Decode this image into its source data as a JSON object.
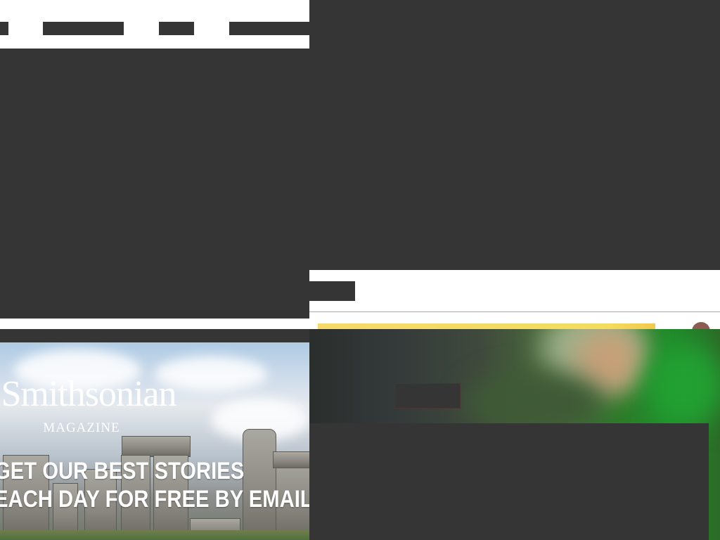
{
  "nav": {
    "items": [
      {
        "label": ""
      },
      {
        "label": ""
      },
      {
        "label": ""
      },
      {
        "label": ""
      }
    ]
  },
  "promo": {
    "logo_title": "Smithsonian",
    "logo_subtitle": "MAGAZINE",
    "headline_line_1": "GET OUR BEST STORIES",
    "headline_line_2": "EACH DAY FOR FREE BY EMAIL"
  },
  "colors": {
    "page_background": "#353535",
    "strip_background": "#ffffff",
    "accent_yellow": "#f4dc5f",
    "stage_green": "#1f8a2a"
  }
}
